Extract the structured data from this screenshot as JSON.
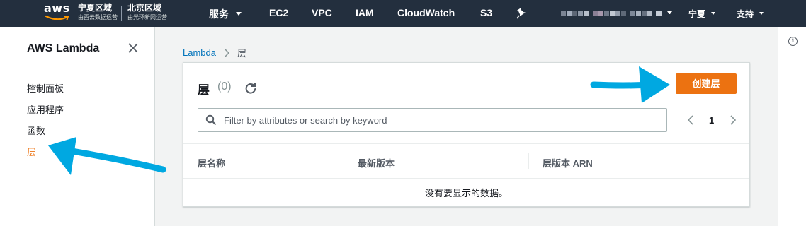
{
  "topnav": {
    "logo_text": "aws",
    "region_ningxia": {
      "name": "宁夏区域",
      "operator": "由西云数据运营"
    },
    "region_beijing": {
      "name": "北京区域",
      "operator": "由光环新网运营"
    },
    "services_label": "服务",
    "ec2_label": "EC2",
    "vpc_label": "VPC",
    "iam_label": "IAM",
    "cloudwatch_label": "CloudWatch",
    "s3_label": "S3",
    "pin_icon": "pin-icon",
    "region_label": "宁夏",
    "support_label": "支持"
  },
  "sidebar": {
    "title": "AWS Lambda",
    "close_icon": "close-icon",
    "items": [
      {
        "label": "控制面板",
        "active": false
      },
      {
        "label": "应用程序",
        "active": false
      },
      {
        "label": "函数",
        "active": false
      },
      {
        "label": "层",
        "active": true
      }
    ]
  },
  "breadcrumb": {
    "root": "Lambda",
    "current": "层"
  },
  "panel": {
    "title": "层",
    "count": "(0)",
    "create_label": "创建层",
    "search_placeholder": "Filter by attributes or search by keyword",
    "page": "1",
    "columns": [
      "层名称",
      "最新版本",
      "层版本 ARN"
    ],
    "empty_text": "没有要显示的数据。"
  },
  "colors": {
    "nav_bg": "#232f3e",
    "accent": "#ec7211",
    "link": "#0073bb",
    "annotation_arrow": "#00a8e1"
  }
}
